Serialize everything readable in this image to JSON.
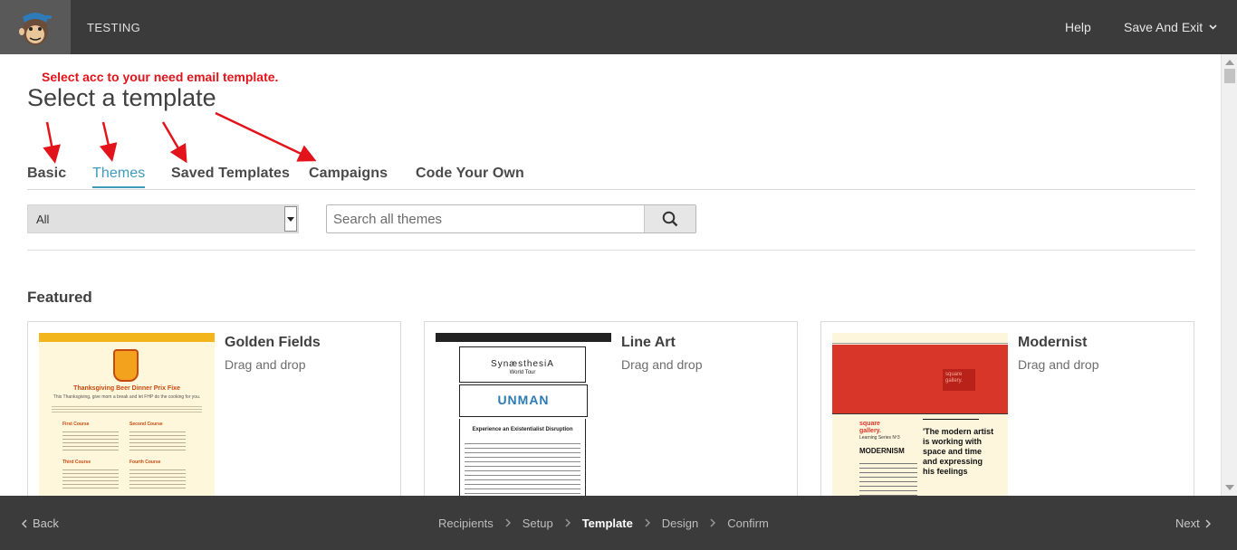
{
  "header": {
    "app_title": "TESTING",
    "help_label": "Help",
    "save_exit_label": "Save And Exit"
  },
  "annotation": "Select acc to your need email template.",
  "page_title": "Select a template",
  "tabs": [
    {
      "label": "Basic",
      "active": false
    },
    {
      "label": "Themes",
      "active": true
    },
    {
      "label": "Saved Templates",
      "active": false
    },
    {
      "label": "Campaigns",
      "active": false
    },
    {
      "label": "Code Your Own",
      "active": false
    }
  ],
  "filter": {
    "selected": "All"
  },
  "search": {
    "placeholder": "Search all themes"
  },
  "featured_label": "Featured",
  "cards": [
    {
      "name": "Golden Fields",
      "subtitle": "Drag and drop",
      "preview": {
        "headline": "Thanksgiving Beer Dinner Prix Fixe",
        "intro": "This Thanksgiving, give mom a break and let FHP do the cooking for you.",
        "sections": [
          "First Course",
          "Second Course",
          "Third Course",
          "Fourth Course"
        ]
      }
    },
    {
      "name": "Line Art",
      "subtitle": "Drag and drop",
      "preview": {
        "title": "SynæsthesiA",
        "subtitle": "World Tour",
        "logo_text": "UNMAN",
        "tagline": "Experience an Existentialist Disruption"
      }
    },
    {
      "name": "Modernist",
      "subtitle": "Drag and drop",
      "preview": {
        "square_label": "square gallery.",
        "brand": "square gallery.",
        "series": "Learning Series Nº3",
        "heading": "MODERNISM",
        "quote": "'The modern artist is working with space and time and expressing his feelings"
      }
    }
  ],
  "footer": {
    "back_label": "Back",
    "next_label": "Next",
    "steps": [
      "Recipients",
      "Setup",
      "Template",
      "Design",
      "Confirm"
    ],
    "current_step": "Template"
  },
  "colors": {
    "bar_bg": "#3b3b3b",
    "accent": "#3e9bb9",
    "annotation": "#e3131b",
    "golden_header": "#f2b51c",
    "modernist_red": "#d9362a"
  }
}
